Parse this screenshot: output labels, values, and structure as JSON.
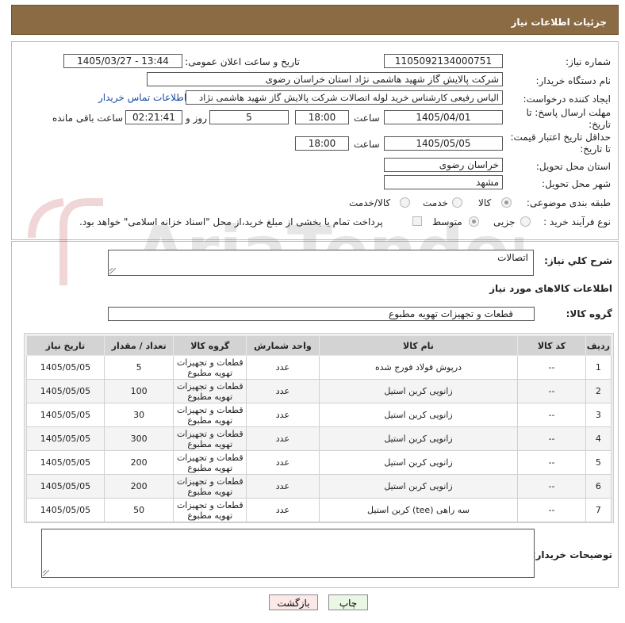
{
  "header": {
    "title": "جزئیات اطلاعات نیاز"
  },
  "form": {
    "need_number_label": "شماره نیاز:",
    "need_number": "1105092134000751",
    "announce_label": "تاریخ و ساعت اعلان عمومی:",
    "announce_value": "1405/03/27 - 13:44",
    "buyer_org_label": "نام دستگاه خریدار:",
    "buyer_org": "شرکت پالایش گاز شهید هاشمی نژاد   استان خراسان رضوی",
    "creator_label": "ایجاد کننده درخواست:",
    "creator": "الیاس رفیعی کارشناس خرید لوله اتصالات شرکت پالایش گاز شهید هاشمی نژاد",
    "contact_link": "اطلاعات تماس خریدار",
    "reply_deadline_label": "مهلت ارسال پاسخ: تا تاریخ:",
    "reply_date": "1405/04/01",
    "time_label": "ساعت",
    "reply_time": "18:00",
    "days_value": "5",
    "days_label": "روز و",
    "remaining_value": "02:21:41",
    "remaining_label": "ساعت باقی مانده",
    "price_deadline_label": "حداقل تاریخ اعتبار قیمت: تا تاریخ:",
    "price_date": "1405/05/05",
    "price_time": "18:00",
    "delivery_province_label": "استان محل تحویل:",
    "delivery_province": "خراسان رضوی",
    "delivery_city_label": "شهر محل تحویل:",
    "delivery_city": "مشهد",
    "category_label": "طبقه بندی موضوعی:",
    "category_options": [
      "کالا",
      "خدمت",
      "کالا/خدمت"
    ],
    "process_label": "نوع فرآیند خرید :",
    "process_options": [
      "جزیی",
      "متوسط"
    ],
    "payment_note": "پرداخت تمام یا بخشی از مبلغ خرید،از محل \"اسناد خزانه اسلامی\" خواهد بود."
  },
  "summary": {
    "label": "شرح کلي نياز:",
    "value": "اتصالات"
  },
  "goods_section": {
    "title": "اطلاعات کالاهای مورد نیاز",
    "group_label": "گروه کالا:",
    "group_value": "قطعات و تجهیزات تهویه مطبوع"
  },
  "table": {
    "columns": [
      "ردیف",
      "کد کالا",
      "نام کالا",
      "واحد شمارش",
      "گروه کالا",
      "تعداد / مقدار",
      "تاریخ نیاز"
    ],
    "rows": [
      [
        "1",
        "--",
        "درپوش فولاد فورج شده",
        "عدد",
        "قطعات و تجهیزات تهویه مطبوع",
        "5",
        "1405/05/05"
      ],
      [
        "2",
        "--",
        "زانویی کربن استیل",
        "عدد",
        "قطعات و تجهیزات تهویه مطبوع",
        "100",
        "1405/05/05"
      ],
      [
        "3",
        "--",
        "زانویی کربن استیل",
        "عدد",
        "قطعات و تجهیزات تهویه مطبوع",
        "30",
        "1405/05/05"
      ],
      [
        "4",
        "--",
        "زانویی کربن استیل",
        "عدد",
        "قطعات و تجهیزات تهویه مطبوع",
        "300",
        "1405/05/05"
      ],
      [
        "5",
        "--",
        "زانویی کربن استیل",
        "عدد",
        "قطعات و تجهیزات تهویه مطبوع",
        "200",
        "1405/05/05"
      ],
      [
        "6",
        "--",
        "زانویی کربن استیل",
        "عدد",
        "قطعات و تجهیزات تهویه مطبوع",
        "200",
        "1405/05/05"
      ],
      [
        "7",
        "--",
        "سه راهی (tee) کربن استیل",
        "عدد",
        "قطعات و تجهیزات تهویه مطبوع",
        "50",
        "1405/05/05"
      ]
    ]
  },
  "buyer_notes": {
    "label": "توضیحات خریدار:",
    "value": ""
  },
  "buttons": {
    "print": "چاپ",
    "back": "بازگشت"
  },
  "watermark": {
    "text": "AriaTender.net"
  },
  "colors": {
    "header_bg": "#8b6b43",
    "table_header_bg": "#d3d3d3",
    "link": "#1a4aa8",
    "back_button_bg": "#fde8e8",
    "print_button_bg": "#eaf7e4"
  }
}
